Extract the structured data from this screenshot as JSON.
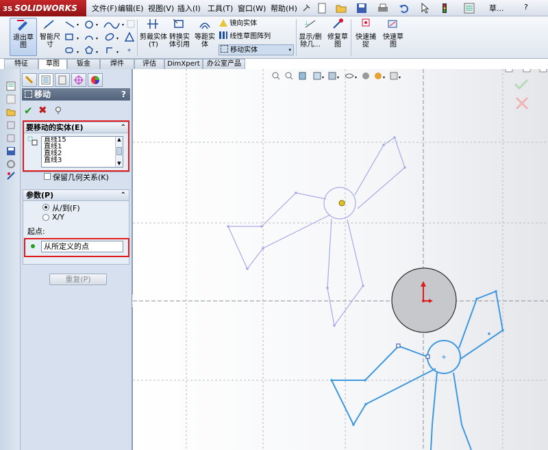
{
  "app": {
    "logo_brand": "SOLIDWORKS",
    "logo_ds": "3S"
  },
  "menu": [
    "文件(F)",
    "编辑(E)",
    "视图(V)",
    "插入(I)",
    "工具(T)",
    "窗口(W)",
    "帮助(H)"
  ],
  "titlebar": {
    "doc_label": "草...",
    "help": "?"
  },
  "ribbon": {
    "exit_sketch": "退出草图",
    "smart_dim": "智能尺寸",
    "trim": "剪裁实体(T)",
    "convert": "转换实体引用",
    "offset": "等距实体",
    "mirror": "镜向实体",
    "linear_pattern": "线性草图阵列",
    "move": "移动实体",
    "display_delete": "显示/删除几...",
    "repair": "修复草图",
    "quick_snap": "快速捕捉",
    "rapid_sketch": "快速草图"
  },
  "tabs": [
    "特征",
    "草图",
    "钣金",
    "焊件",
    "评估",
    "DimXpert",
    "办公室产品"
  ],
  "active_tab": 1,
  "pm": {
    "title": "移动",
    "help": "?",
    "entities_group": {
      "title": "要移动的实体(E)",
      "items": [
        "直线15",
        "直线1",
        "直线2",
        "直线3"
      ],
      "keep_relations": "保留几何关系(K)"
    },
    "params_group": {
      "title": "参数(P)",
      "option_from_to": "从/到(F)",
      "option_xy": "X/Y",
      "start_label": "起点:",
      "start_value": "从所定义的点"
    },
    "reset": "重复(P)"
  },
  "colors": {
    "ghost": "#a9a8e8",
    "active_sketch": "#3d98e0",
    "highlight_red": "#e01a1a"
  }
}
